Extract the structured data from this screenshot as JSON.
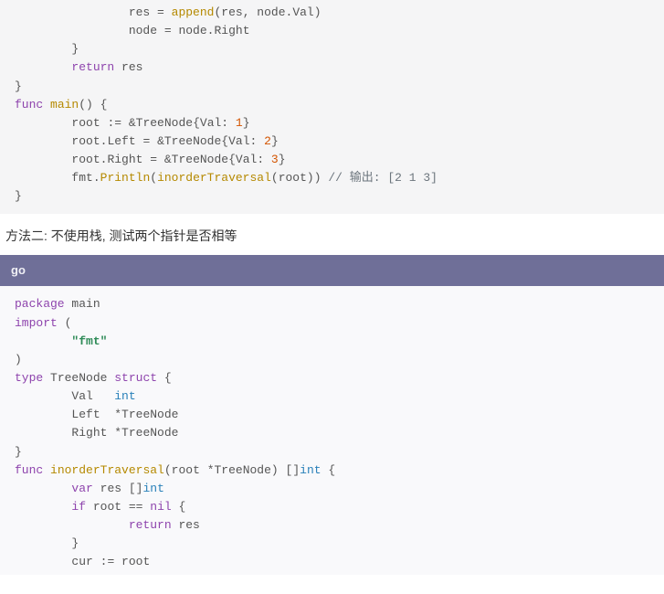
{
  "block1": {
    "lines": [
      [
        [
          "",
          "                "
        ],
        [
          "id",
          "res "
        ],
        [
          "op",
          "= "
        ],
        [
          "fn",
          "append"
        ],
        [
          "op",
          "("
        ],
        [
          "id",
          "res"
        ],
        [
          "op",
          ", "
        ],
        [
          "id",
          "node"
        ],
        [
          "op",
          "."
        ],
        [
          "id",
          "Val"
        ],
        [
          "op",
          ")"
        ]
      ],
      [
        [
          "",
          "                "
        ],
        [
          "id",
          "node "
        ],
        [
          "op",
          "= "
        ],
        [
          "id",
          "node"
        ],
        [
          "op",
          "."
        ],
        [
          "id",
          "Right"
        ]
      ],
      [
        [
          "",
          "        "
        ],
        [
          "op",
          "}"
        ]
      ],
      [
        [
          "",
          "        "
        ],
        [
          "kw",
          "return"
        ],
        [
          "",
          " "
        ],
        [
          "id",
          "res"
        ]
      ],
      [
        [
          "op",
          "}"
        ]
      ],
      [
        [
          "",
          ""
        ]
      ],
      [
        [
          "kw",
          "func"
        ],
        [
          "",
          " "
        ],
        [
          "fn",
          "main"
        ],
        [
          "op",
          "()"
        ],
        [
          "",
          " "
        ],
        [
          "op",
          "{"
        ]
      ],
      [
        [
          "",
          "        "
        ],
        [
          "id",
          "root "
        ],
        [
          "op",
          ":= &"
        ],
        [
          "id",
          "TreeNode"
        ],
        [
          "op",
          "{"
        ],
        [
          "id",
          "Val"
        ],
        [
          "op",
          ": "
        ],
        [
          "num",
          "1"
        ],
        [
          "op",
          "}"
        ]
      ],
      [
        [
          "",
          "        "
        ],
        [
          "id",
          "root"
        ],
        [
          "op",
          "."
        ],
        [
          "id",
          "Left "
        ],
        [
          "op",
          "= &"
        ],
        [
          "id",
          "TreeNode"
        ],
        [
          "op",
          "{"
        ],
        [
          "id",
          "Val"
        ],
        [
          "op",
          ": "
        ],
        [
          "num",
          "2"
        ],
        [
          "op",
          "}"
        ]
      ],
      [
        [
          "",
          "        "
        ],
        [
          "id",
          "root"
        ],
        [
          "op",
          "."
        ],
        [
          "id",
          "Right "
        ],
        [
          "op",
          "= &"
        ],
        [
          "id",
          "TreeNode"
        ],
        [
          "op",
          "{"
        ],
        [
          "id",
          "Val"
        ],
        [
          "op",
          ": "
        ],
        [
          "num",
          "3"
        ],
        [
          "op",
          "}"
        ]
      ],
      [
        [
          "",
          "        "
        ],
        [
          "id",
          "fmt"
        ],
        [
          "op",
          "."
        ],
        [
          "fn",
          "Println"
        ],
        [
          "op",
          "("
        ],
        [
          "fn",
          "inorderTraversal"
        ],
        [
          "op",
          "("
        ],
        [
          "id",
          "root"
        ],
        [
          "op",
          "))"
        ],
        [
          "",
          " "
        ],
        [
          "cmt",
          "// 输出: [2 1 3]"
        ]
      ],
      [
        [
          "op",
          "}"
        ]
      ]
    ]
  },
  "prose": "方法二: 不使用栈, 测试两个指针是否相等",
  "langHeader": "go",
  "block2": {
    "lines": [
      [
        [
          "kw",
          "package"
        ],
        [
          "",
          " "
        ],
        [
          "id",
          "main"
        ]
      ],
      [
        [
          "",
          ""
        ]
      ],
      [
        [
          "kw",
          "import"
        ],
        [
          "",
          " "
        ],
        [
          "op",
          "("
        ]
      ],
      [
        [
          "",
          "        "
        ],
        [
          "str",
          "\"fmt\""
        ]
      ],
      [
        [
          "op",
          ")"
        ]
      ],
      [
        [
          "",
          ""
        ]
      ],
      [
        [
          "kw",
          "type"
        ],
        [
          "",
          " "
        ],
        [
          "id",
          "TreeNode "
        ],
        [
          "kw",
          "struct"
        ],
        [
          "",
          " "
        ],
        [
          "op",
          "{"
        ]
      ],
      [
        [
          "",
          "        "
        ],
        [
          "id",
          "Val   "
        ],
        [
          "typ",
          "int"
        ]
      ],
      [
        [
          "",
          "        "
        ],
        [
          "id",
          "Left  "
        ],
        [
          "op",
          "*"
        ],
        [
          "id",
          "TreeNode"
        ]
      ],
      [
        [
          "",
          "        "
        ],
        [
          "id",
          "Right "
        ],
        [
          "op",
          "*"
        ],
        [
          "id",
          "TreeNode"
        ]
      ],
      [
        [
          "op",
          "}"
        ]
      ],
      [
        [
          "",
          ""
        ]
      ],
      [
        [
          "kw",
          "func"
        ],
        [
          "",
          " "
        ],
        [
          "fn",
          "inorderTraversal"
        ],
        [
          "op",
          "("
        ],
        [
          "id",
          "root "
        ],
        [
          "op",
          "*"
        ],
        [
          "id",
          "TreeNode"
        ],
        [
          "op",
          ")"
        ],
        [
          "",
          " "
        ],
        [
          "op",
          "[]"
        ],
        [
          "typ",
          "int"
        ],
        [
          "",
          " "
        ],
        [
          "op",
          "{"
        ]
      ],
      [
        [
          "",
          "        "
        ],
        [
          "kw",
          "var"
        ],
        [
          "",
          " "
        ],
        [
          "id",
          "res "
        ],
        [
          "op",
          "[]"
        ],
        [
          "typ",
          "int"
        ]
      ],
      [
        [
          "",
          "        "
        ],
        [
          "kw",
          "if"
        ],
        [
          "",
          " "
        ],
        [
          "id",
          "root "
        ],
        [
          "op",
          "== "
        ],
        [
          "nil",
          "nil"
        ],
        [
          "",
          " "
        ],
        [
          "op",
          "{"
        ]
      ],
      [
        [
          "",
          "                "
        ],
        [
          "kw",
          "return"
        ],
        [
          "",
          " "
        ],
        [
          "id",
          "res"
        ]
      ],
      [
        [
          "",
          "        "
        ],
        [
          "op",
          "}"
        ]
      ],
      [
        [
          "",
          "        "
        ],
        [
          "id",
          "cur "
        ],
        [
          "op",
          ":= "
        ],
        [
          "id",
          "root"
        ]
      ]
    ]
  }
}
